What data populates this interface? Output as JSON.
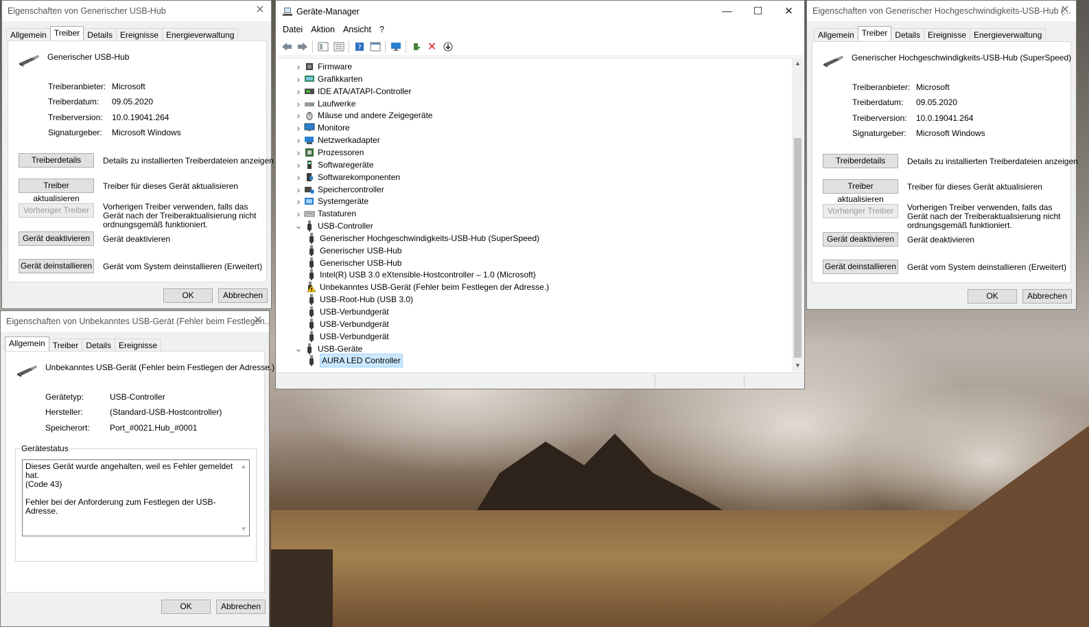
{
  "left_top_dialog": {
    "title": "Eigenschaften von Generischer USB-Hub",
    "tabs": [
      "Allgemein",
      "Treiber",
      "Details",
      "Ereignisse",
      "Energieverwaltung"
    ],
    "device_name": "Generischer USB-Hub",
    "fields": [
      {
        "label": "Treiberanbieter:",
        "value": "Microsoft"
      },
      {
        "label": "Treiberdatum:",
        "value": "09.05.2020"
      },
      {
        "label": "Treiberversion:",
        "value": "10.0.19041.264"
      },
      {
        "label": "Signaturgeber:",
        "value": "Microsoft Windows"
      }
    ],
    "actions": [
      {
        "button": "Treiberdetails",
        "desc": "Details zu installierten Treiberdateien anzeigen"
      },
      {
        "button": "Treiber aktualisieren",
        "desc": "Treiber für dieses Gerät aktualisieren"
      },
      {
        "button": "Vorheriger Treiber",
        "desc": "Vorherigen Treiber verwenden, falls das Gerät nach der Treiberaktualisierung nicht ordnungsgemäß funktioniert."
      },
      {
        "button": "Gerät deaktivieren",
        "desc": "Gerät deaktivieren"
      },
      {
        "button": "Gerät deinstallieren",
        "desc": "Gerät vom System deinstallieren (Erweitert)"
      }
    ],
    "ok": "OK",
    "cancel": "Abbrechen"
  },
  "right_top_dialog": {
    "title": "Eigenschaften von Generischer Hochgeschwindigkeits-USB-Hub (...",
    "tabs": [
      "Allgemein",
      "Treiber",
      "Details",
      "Ereignisse",
      "Energieverwaltung"
    ],
    "device_name": "Generischer Hochgeschwindigkeits-USB-Hub (SuperSpeed)",
    "fields": [
      {
        "label": "Treiberanbieter:",
        "value": "Microsoft"
      },
      {
        "label": "Treiberdatum:",
        "value": "09.05.2020"
      },
      {
        "label": "Treiberversion:",
        "value": "10.0.19041.264"
      },
      {
        "label": "Signaturgeber:",
        "value": "Microsoft Windows"
      }
    ],
    "actions": [
      {
        "button": "Treiberdetails",
        "desc": "Details zu installierten Treiberdateien anzeigen"
      },
      {
        "button": "Treiber aktualisieren",
        "desc": "Treiber für dieses Gerät aktualisieren"
      },
      {
        "button": "Vorheriger Treiber",
        "desc": "Vorherigen Treiber verwenden, falls das Gerät nach der Treiberaktualisierung nicht ordnungsgemäß funktioniert."
      },
      {
        "button": "Gerät deaktivieren",
        "desc": "Gerät deaktivieren"
      },
      {
        "button": "Gerät deinstallieren",
        "desc": "Gerät vom System deinstallieren (Erweitert)"
      }
    ],
    "ok": "OK",
    "cancel": "Abbrechen"
  },
  "left_bottom_dialog": {
    "title": "Eigenschaften von Unbekanntes USB-Gerät (Fehler beim Festlegen...",
    "tabs": [
      "Allgemein",
      "Treiber",
      "Details",
      "Ereignisse"
    ],
    "device_name": "Unbekanntes USB-Gerät (Fehler beim Festlegen der Adresse.)",
    "fields": [
      {
        "label": "Gerätetyp:",
        "value": "USB-Controller"
      },
      {
        "label": "Hersteller:",
        "value": "(Standard-USB-Hostcontroller)"
      },
      {
        "label": "Speicherort:",
        "value": "Port_#0021.Hub_#0001"
      }
    ],
    "status_legend": "Gerätestatus",
    "status_line1": "Dieses Gerät wurde angehalten, weil es Fehler gemeldet hat.",
    "status_line2": "(Code 43)",
    "status_line3": "Fehler bei der Anforderung zum Festlegen der USB-Adresse.",
    "ok": "OK",
    "cancel": "Abbrechen"
  },
  "device_manager": {
    "title": "Geräte-Manager",
    "menu": [
      "Datei",
      "Aktion",
      "Ansicht",
      "?"
    ],
    "tree": [
      {
        "label": "Firmware",
        "level": 0,
        "state": "collapsed",
        "icon": "chip-icon"
      },
      {
        "label": "Grafikkarten",
        "level": 0,
        "state": "collapsed",
        "icon": "display-adapter-icon"
      },
      {
        "label": "IDE ATA/ATAPI-Controller",
        "level": 0,
        "state": "collapsed",
        "icon": "ide-icon"
      },
      {
        "label": "Laufwerke",
        "level": 0,
        "state": "collapsed",
        "icon": "drive-icon"
      },
      {
        "label": "Mäuse und andere Zeigegeräte",
        "level": 0,
        "state": "collapsed",
        "icon": "mouse-icon"
      },
      {
        "label": "Monitore",
        "level": 0,
        "state": "collapsed",
        "icon": "monitor-icon"
      },
      {
        "label": "Netzwerkadapter",
        "level": 0,
        "state": "collapsed",
        "icon": "network-icon"
      },
      {
        "label": "Prozessoren",
        "level": 0,
        "state": "collapsed",
        "icon": "cpu-icon"
      },
      {
        "label": "Softwaregeräte",
        "level": 0,
        "state": "collapsed",
        "icon": "software-device-icon"
      },
      {
        "label": "Softwarekomponenten",
        "level": 0,
        "state": "collapsed",
        "icon": "software-component-icon"
      },
      {
        "label": "Speichercontroller",
        "level": 0,
        "state": "collapsed",
        "icon": "storage-icon"
      },
      {
        "label": "Systemgeräte",
        "level": 0,
        "state": "collapsed",
        "icon": "system-icon"
      },
      {
        "label": "Tastaturen",
        "level": 0,
        "state": "collapsed",
        "icon": "keyboard-icon"
      },
      {
        "label": "USB-Controller",
        "level": 0,
        "state": "expanded",
        "icon": "usb-icon"
      },
      {
        "label": "Generischer Hochgeschwindigkeits-USB-Hub (SuperSpeed)",
        "level": 1,
        "icon": "usb-icon"
      },
      {
        "label": "Generischer USB-Hub",
        "level": 1,
        "icon": "usb-icon"
      },
      {
        "label": "Generischer USB-Hub",
        "level": 1,
        "icon": "usb-icon"
      },
      {
        "label": "Intel(R) USB 3.0 eXtensible-Hostcontroller – 1.0 (Microsoft)",
        "level": 1,
        "icon": "usb-icon"
      },
      {
        "label": "Unbekanntes USB-Gerät (Fehler beim Festlegen der Adresse.)",
        "level": 1,
        "icon": "warning-icon"
      },
      {
        "label": "USB-Root-Hub (USB 3.0)",
        "level": 1,
        "icon": "usb-icon"
      },
      {
        "label": "USB-Verbundgerät",
        "level": 1,
        "icon": "usb-icon"
      },
      {
        "label": "USB-Verbundgerät",
        "level": 1,
        "icon": "usb-icon"
      },
      {
        "label": "USB-Verbundgerät",
        "level": 1,
        "icon": "usb-icon"
      },
      {
        "label": "USB-Geräte",
        "level": 0,
        "state": "expanded",
        "icon": "usb-icon"
      },
      {
        "label": "AURA LED Controller",
        "level": 1,
        "icon": "usb-icon",
        "selected": true
      }
    ]
  }
}
